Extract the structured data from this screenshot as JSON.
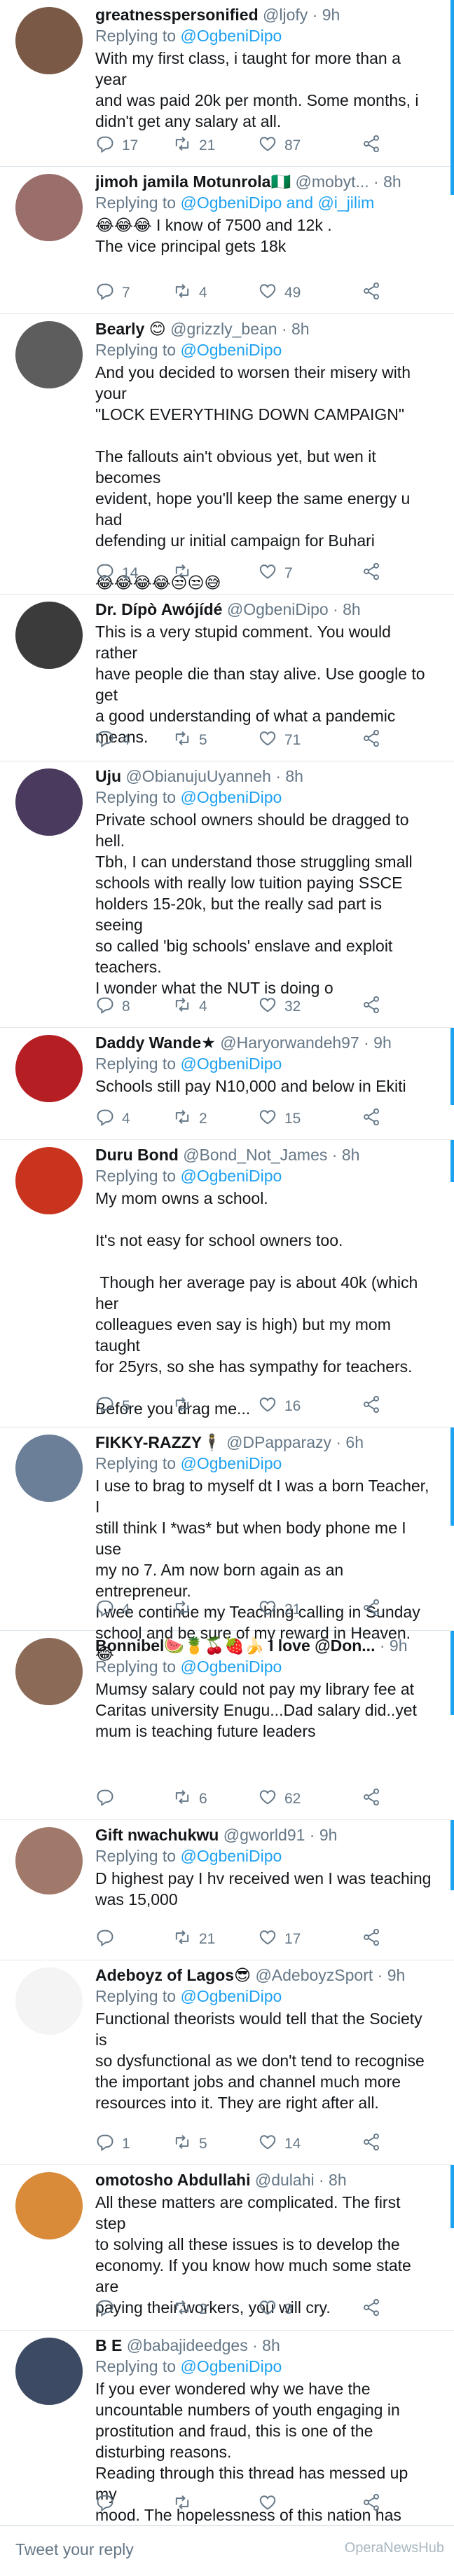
{
  "tweets": [
    {
      "name": "greatnesspersonified",
      "handle": "@ljofy · 9h",
      "reply_prefix": "Replying to ",
      "reply_to": "@OgbeniDipo",
      "text": "With my first class, i taught for more than a year\nand was paid 20k per month. Some months, i\ndidn't get any salary at all.",
      "replies": "17",
      "retweets": "21",
      "likes": "87",
      "avatar": "#7a5a46"
    },
    {
      "name": "jimoh jamila Motunrola🇳🇬",
      "handle": "@mobyt... · 8h",
      "reply_prefix": "Replying to ",
      "reply_to": "@OgbeniDipo and @i_jilim",
      "text": "😂😂😂 I know of 7500 and 12k .\nThe vice principal gets 18k",
      "replies": "7",
      "retweets": "4",
      "likes": "49",
      "avatar": "#9a6e6a"
    },
    {
      "name": "Bearly 😊",
      "handle": "@grizzly_bean · 8h",
      "reply_prefix": "Replying to ",
      "reply_to": "@OgbeniDipo",
      "text": "And you decided to worsen their misery with your\n\"LOCK EVERYTHING DOWN CAMPAIGN\"\n\nThe fallouts ain't obvious yet, but wen it becomes\nevident, hope you'll keep the same energy u had\ndefending ur initial campaign for Buhari\n\n😂😂😂😂😒😒😅",
      "replies": "14",
      "retweets": "",
      "likes": "7",
      "avatar": "#5d5d5d"
    },
    {
      "name": "Dr. Dípò Awójídé",
      "handle": "@OgbeniDipo · 8h",
      "reply_prefix": "",
      "reply_to": "",
      "text": "This is a very stupid comment. You would rather\nhave people die than stay alive. Use google to get\na good understanding of what a pandemic\nmeans.",
      "replies": "4",
      "retweets": "5",
      "likes": "71",
      "avatar": "#3b3b3b"
    },
    {
      "name": "Uju",
      "handle": "@ObianujuUyanneh · 8h",
      "reply_prefix": "Replying to ",
      "reply_to": "@OgbeniDipo",
      "text": "Private school owners should be dragged to hell.\nTbh, I can understand those struggling small\nschools with really low tuition paying SSCE\nholders 15-20k, but the really sad part is seeing\nso called 'big schools' enslave and exploit\nteachers.\nI wonder what the NUT is doing o",
      "replies": "8",
      "retweets": "4",
      "likes": "32",
      "avatar": "#4a3a5e"
    },
    {
      "name": "Daddy Wande★",
      "handle": "@Haryorwandeh97 · 9h",
      "reply_prefix": "Replying to ",
      "reply_to": "@OgbeniDipo",
      "text": "Schools still pay N10,000 and below in Ekiti",
      "replies": "4",
      "retweets": "2",
      "likes": "15",
      "avatar": "#b51f24"
    },
    {
      "name": "Duru Bond",
      "handle": "@Bond_Not_James · 8h",
      "reply_prefix": "Replying to ",
      "reply_to": "@OgbeniDipo",
      "text": "My mom owns a school.\n\nIt's not easy for school owners too.\n\n Though her average pay is about 40k (which her\ncolleagues even say is high) but my mom taught\nfor 25yrs, so she has sympathy for teachers.\n\nBefore you drag me...",
      "replies": "5",
      "retweets": "",
      "likes": "16",
      "avatar": "#c9341f"
    },
    {
      "name": "FIKKY-RAZZY🕴",
      "handle": "@DPapparazy · 6h",
      "reply_prefix": "Replying to ",
      "reply_to": "@OgbeniDipo",
      "text": "I use to brag to myself dt I was a born Teacher, I\nstill think I *was* but when body phone me I use\nmy no 7. Am now born again as an entrepreneur.\nI wee continue my Teaching calling in Sunday\nschool and be sure of my reward in Heaven. 😂",
      "replies": "4",
      "retweets": "",
      "likes": "21",
      "avatar": "#6b7f99"
    },
    {
      "name": "Bonnibel🍉🍍🍒🍓🍌 I love @Don...",
      "handle": "· 9h",
      "reply_prefix": "Replying to ",
      "reply_to": "@OgbeniDipo",
      "text": "Mumsy salary could not pay my library fee at\nCaritas university Enugu...Dad salary did..yet\nmum is teaching future leaders",
      "replies": "",
      "retweets": "6",
      "likes": "62",
      "avatar": "#8b6a57"
    },
    {
      "name": "Gift nwachukwu",
      "handle": "@gworld91 · 9h",
      "reply_prefix": "Replying to ",
      "reply_to": "@OgbeniDipo",
      "text": "D highest pay I hv received wen I was teaching\nwas 15,000",
      "replies": "",
      "retweets": "21",
      "likes": "17",
      "avatar": "#a0796b"
    },
    {
      "name": "Adeboyz of Lagos😎",
      "handle": "@AdeboyzSport · 9h",
      "reply_prefix": "Replying to ",
      "reply_to": "@OgbeniDipo",
      "text": "Functional theorists would tell that the Society is\nso dysfunctional as we don't tend to recognise\nthe important jobs and channel much more\nresources into it. They are right after all.",
      "replies": "1",
      "retweets": "5",
      "likes": "14",
      "avatar": "#f4f4f4"
    },
    {
      "name": "omotosho Abdullahi",
      "handle": "@dulahi · 8h",
      "reply_prefix": "",
      "reply_to": "",
      "text": "All these matters are complicated. The first step\nto solving all these issues is to develop the\neconomy. If you know how much some state are\npaying their workers, you will cry.",
      "replies": "",
      "retweets": "2",
      "likes": "3",
      "avatar": "#d98b3a"
    },
    {
      "name": "B E",
      "handle": "@babajideedges · 8h",
      "reply_prefix": "Replying to ",
      "reply_to": "@OgbeniDipo",
      "text": "If you ever wondered why we have the\nuncountable numbers of youth engaging in\nprostitution and fraud, this is one of the\ndisturbing reasons.\nReading through this thread has messed up my\nmood. The hopelessness of this nation has",
      "replies": "",
      "retweets": "",
      "likes": "",
      "avatar": "#3c4a63"
    }
  ],
  "compose": {
    "placeholder": "Tweet your reply"
  },
  "watermark": "OperaNewsHub",
  "colors": {
    "link": "#1da1f2",
    "muted": "#657786",
    "text": "#14171a",
    "divider": "#e1e8ed"
  }
}
